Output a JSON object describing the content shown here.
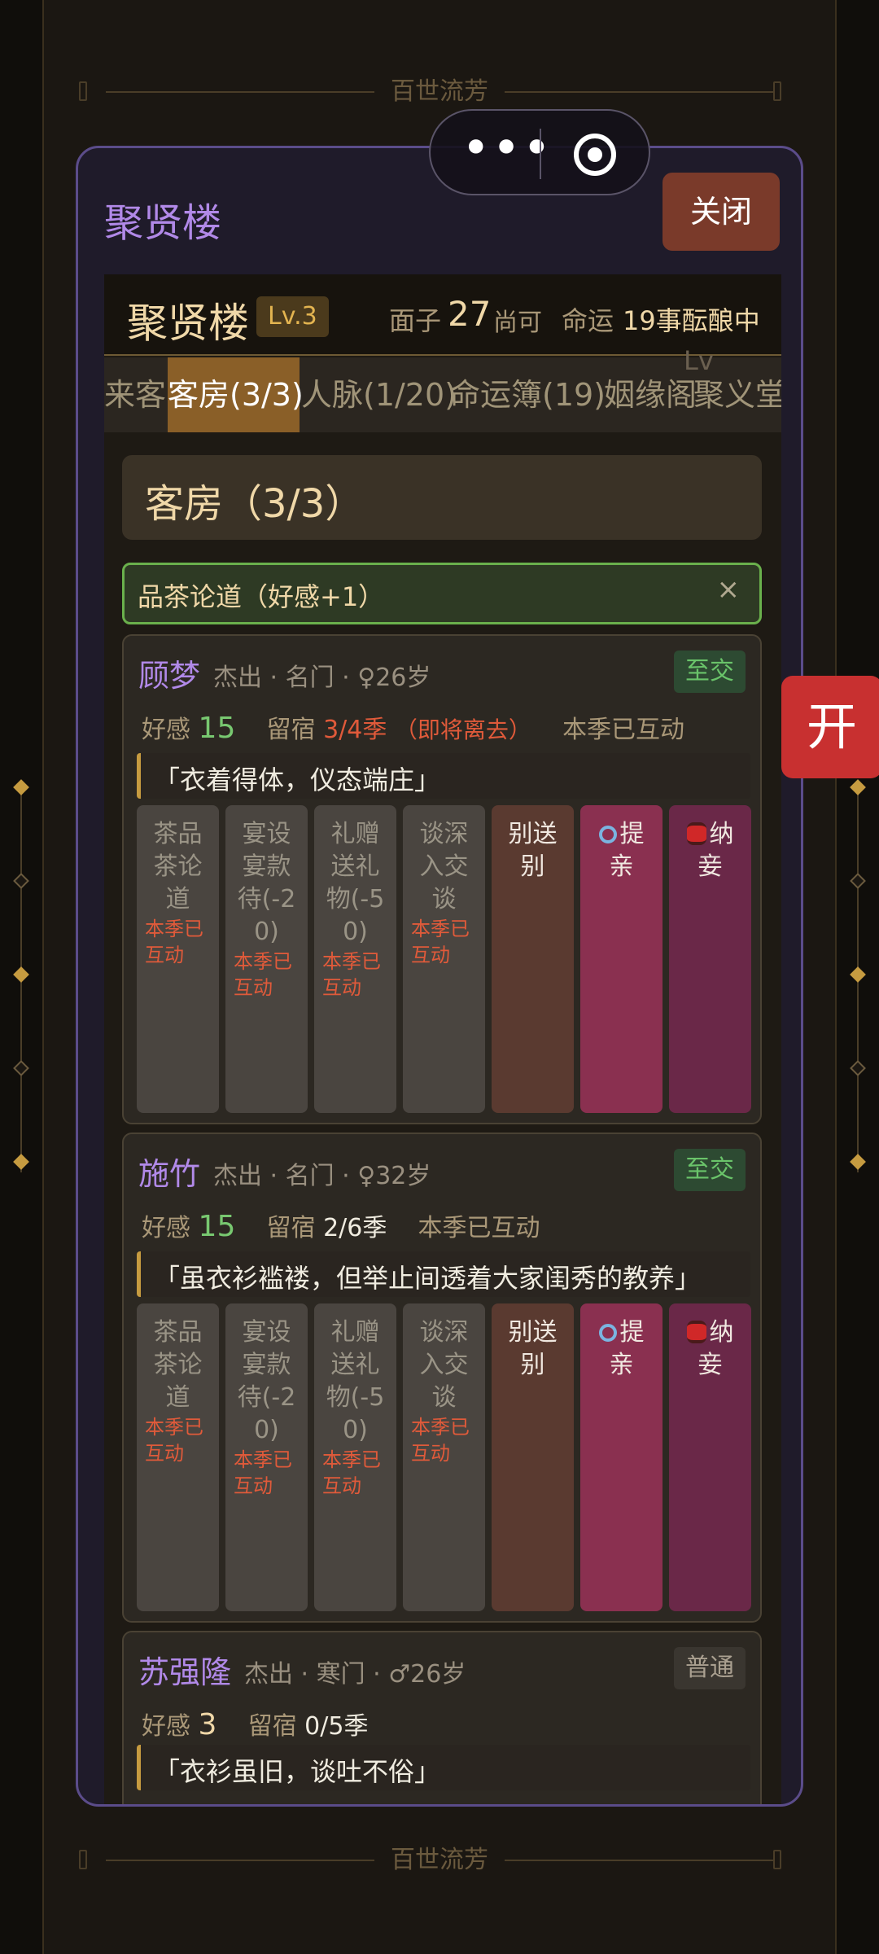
{
  "background": {
    "banner_top": "百世流芳",
    "banner_bottom": "百世流芳"
  },
  "capsule": {
    "more_icon": "more-dots-icon",
    "close_icon": "target-circle-icon"
  },
  "side_button": {
    "label": "开"
  },
  "modal": {
    "title": "聚贤楼",
    "close_label": "关闭"
  },
  "hall": {
    "name": "聚贤楼",
    "level": "Lv.3",
    "face_label": "面子",
    "face_value": "27",
    "face_grade": "尚可",
    "fate_label": "命运",
    "fate_value": "19事酝酿中"
  },
  "tabs": [
    {
      "label": "来客"
    },
    {
      "label": "客房(3/3)",
      "active": true
    },
    {
      "label": "人脉(1/20)"
    },
    {
      "label": "命运簿(19)"
    },
    {
      "label": "姻缘阁"
    },
    {
      "label": "聚义堂"
    }
  ],
  "section": {
    "title": "客房（3/3）",
    "peek": "Lv"
  },
  "toast": {
    "text": "品茶论道（好感+1）",
    "close": "×"
  },
  "guests": [
    {
      "name": "顾梦",
      "meta": "杰出 · 名门 · ♀26岁",
      "relation": "至交",
      "favor_label": "好感",
      "favor": "15",
      "stay_label": "留宿",
      "stay": "3/4季",
      "stay_warning": "（即将离去）",
      "interacted": "本季已互动",
      "quote": "「衣着得体，仪态端庄」",
      "actions": [
        {
          "label": "茶品茶论道",
          "note": "本季已互动"
        },
        {
          "label": "宴设宴款待(-20)",
          "note": "本季已互动"
        },
        {
          "label": "礼赠送礼物(-50)",
          "note": "本季已互动"
        },
        {
          "label": "谈深入交谈",
          "note": "本季已互动"
        },
        {
          "label": "别送别"
        },
        {
          "label": "提亲"
        },
        {
          "label": "纳妾"
        }
      ]
    },
    {
      "name": "施竹",
      "meta": "杰出 · 名门 · ♀32岁",
      "relation": "至交",
      "favor_label": "好感",
      "favor": "15",
      "stay_label": "留宿",
      "stay": "2/6季",
      "interacted": "本季已互动",
      "quote": "「虽衣衫褴褛，但举止间透着大家闺秀的教养」",
      "actions": [
        {
          "label": "茶品茶论道",
          "note": "本季已互动"
        },
        {
          "label": "宴设宴款待(-20)",
          "note": "本季已互动"
        },
        {
          "label": "礼赠送礼物(-50)",
          "note": "本季已互动"
        },
        {
          "label": "谈深入交谈",
          "note": "本季已互动"
        },
        {
          "label": "别送别"
        },
        {
          "label": "提亲"
        },
        {
          "label": "纳妾"
        }
      ]
    },
    {
      "name": "苏强隆",
      "meta": "杰出 · 寒门 · ♂26岁",
      "relation": "普通",
      "favor_label": "好感",
      "favor": "3",
      "stay_label": "留宿",
      "stay": "0/5季",
      "quote": "「衣衫虽旧，谈吐不俗」"
    }
  ],
  "colors": {
    "accent_purple": "#b189e8",
    "gold": "#f0d8a8",
    "warn_red": "#e05a3a",
    "favor_green": "#78c870",
    "active_tab": "#8a5f28"
  }
}
